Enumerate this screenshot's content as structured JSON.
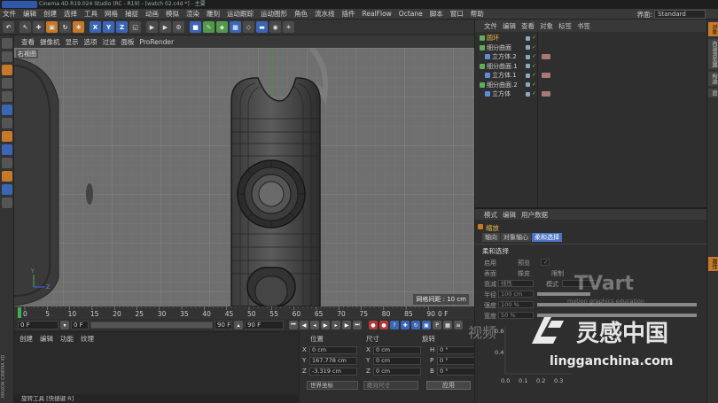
{
  "titlebar": {
    "text": "Cinema 4D R19.024 Studio (RC - R19) - [watch 02.c4d *] - 主要"
  },
  "menubar": {
    "items": [
      "文件",
      "编辑",
      "创建",
      "选择",
      "工具",
      "网格",
      "捕捉",
      "动画",
      "模拟",
      "渲染",
      "雕刻",
      "运动跟踪",
      "运动图形",
      "角色",
      "流水线",
      "插件",
      "RealFlow",
      "Octane",
      "脚本",
      "窗口",
      "帮助"
    ],
    "layout_label": "界面:",
    "layout_value": "Standard"
  },
  "toolbar": {
    "axis_buttons": [
      "X",
      "Y",
      "Z"
    ]
  },
  "viewport": {
    "menu": [
      "查看",
      "摄像机",
      "显示",
      "选项",
      "过滤",
      "面板",
      "ProRender"
    ],
    "view_name": "右视图",
    "grid_spacing": "网格间距 : 10 cm"
  },
  "timeline": {
    "ticks": [
      "0",
      "5",
      "10",
      "15",
      "20",
      "25",
      "30",
      "35",
      "40",
      "45",
      "50",
      "55",
      "60",
      "65",
      "70",
      "75",
      "80",
      "85",
      "90"
    ],
    "current_frame": "0 F"
  },
  "transport": {
    "start": "0 F",
    "range_start": "0 F",
    "range_end": "90 F",
    "end": "90 F"
  },
  "material_panel": {
    "menu": [
      "创建",
      "编辑",
      "功能",
      "纹理"
    ]
  },
  "maxon_label": "MAXON CINEMA 4D",
  "status_bar": {
    "text": "旋转工具 [快捷键 R]"
  },
  "coords": {
    "headers": {
      "position": "位置",
      "size": "尺寸",
      "rotation": "旋转"
    },
    "rows": [
      {
        "axis": "X",
        "pos": "0 cm",
        "size_axis": "X",
        "size": "0 cm",
        "rot_axis": "H",
        "rot": "0 °"
      },
      {
        "axis": "Y",
        "pos": "167.778 cm",
        "size_axis": "Y",
        "size": "0 cm",
        "rot_axis": "P",
        "rot": "0 °"
      },
      {
        "axis": "Z",
        "pos": "-3.319 cm",
        "size_axis": "Z",
        "size": "0 cm",
        "rot_axis": "B",
        "rot": "0 °"
      }
    ],
    "coord_system": "世界坐标",
    "size_mode": "绝对尺寸",
    "apply": "应用"
  },
  "object_manager": {
    "menu": [
      "文件",
      "编辑",
      "查看",
      "对象",
      "标签",
      "书签"
    ],
    "objects": [
      {
        "name": "圆环",
        "indent": 0,
        "selected": true,
        "tags": false
      },
      {
        "name": "细分曲面",
        "indent": 0,
        "selected": false,
        "tags": false
      },
      {
        "name": "立方体.2",
        "indent": 1,
        "selected": false,
        "tags": true
      },
      {
        "name": "细分曲面.1",
        "indent": 0,
        "selected": false,
        "tags": false
      },
      {
        "name": "立方体.1",
        "indent": 1,
        "selected": false,
        "tags": true
      },
      {
        "name": "细分曲面.2",
        "indent": 0,
        "selected": false,
        "tags": false
      },
      {
        "name": "立方体",
        "indent": 1,
        "selected": false,
        "tags": true
      }
    ]
  },
  "attributes": {
    "menu": [
      "模式",
      "编辑",
      "用户数据"
    ],
    "title": "缩放",
    "tabs": [
      "轴向",
      "对象轴心",
      "柔和选择"
    ],
    "active_tab": "柔和选择",
    "section": "柔和选择",
    "fields": [
      {
        "label": "启用",
        "value": ""
      },
      {
        "label": "预览",
        "value": "✓"
      },
      {
        "label": "表面",
        "value": ""
      },
      {
        "label": "橡皮",
        "value": ""
      },
      {
        "label": "限制",
        "value": ""
      },
      {
        "label": "衰减",
        "value": "线性"
      },
      {
        "label": "模式",
        "value": ""
      },
      {
        "label": "半径",
        "value": "100 cm"
      },
      {
        "label": "强度",
        "value": "100 %"
      },
      {
        "label": "宽度",
        "value": "50 %"
      }
    ],
    "graph_ticks": [
      "0.0",
      "0.1",
      "0.2",
      "0.3"
    ],
    "graph_yticks": [
      "0.8",
      "0.4"
    ]
  },
  "right_strip": {
    "tabs": [
      "对象",
      "内容浏览器",
      "构造",
      "层",
      "属性"
    ]
  },
  "watermark": {
    "brand": "TVart",
    "brand_sub": "motion graphics education",
    "video": "视频",
    "cn": "灵感中国",
    "en": "lingganchina.com"
  }
}
